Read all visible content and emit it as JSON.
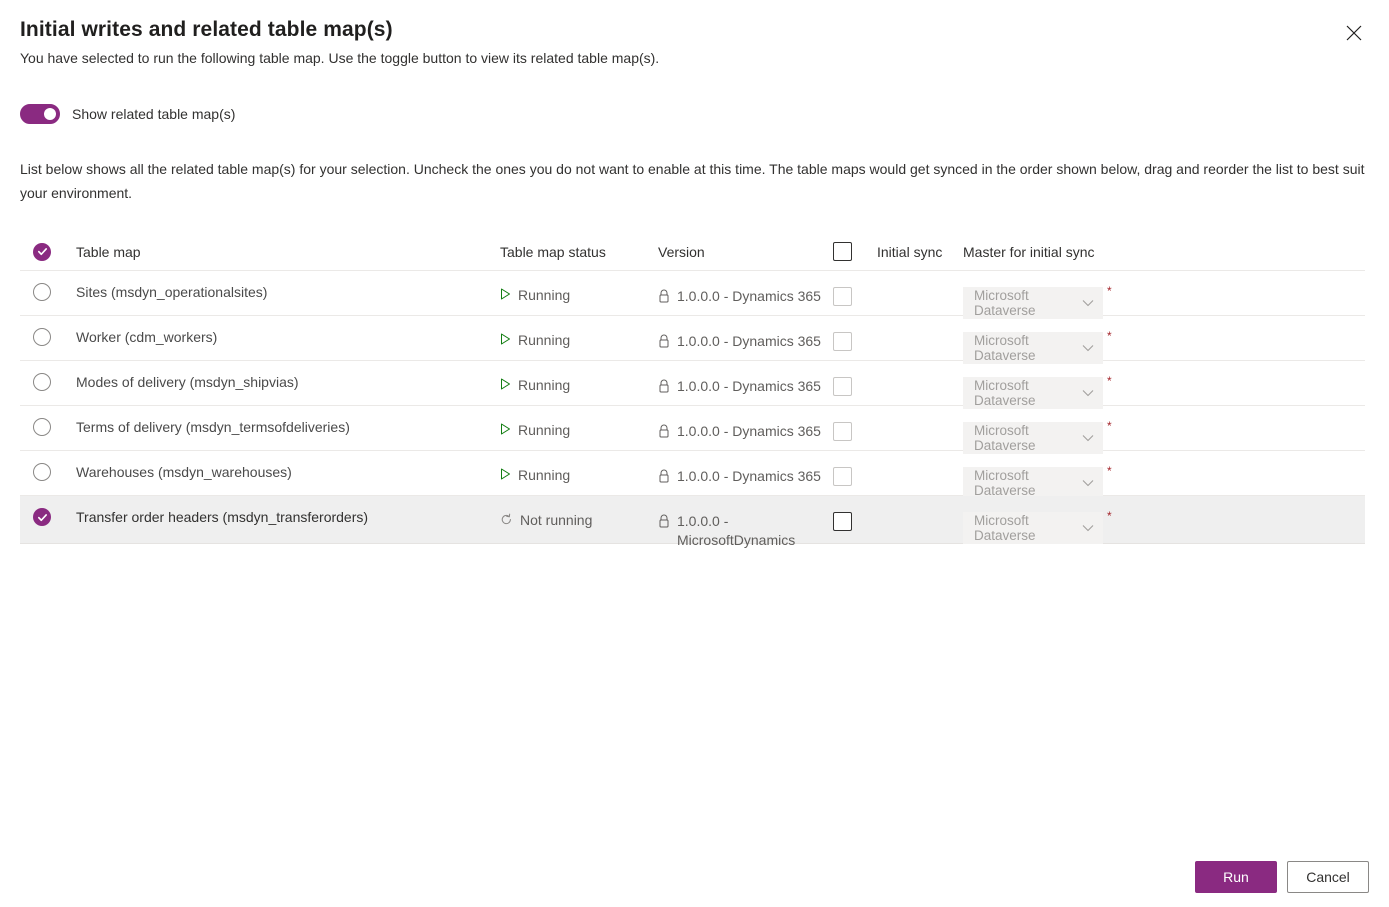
{
  "dialog": {
    "title": "Initial writes and related table map(s)",
    "subtitle": "You have selected to run the following table map. Use the toggle button to view its related table map(s).",
    "close_icon": "close-icon",
    "description": "List below shows all the related table map(s) for your selection. Uncheck the ones you do not want to enable at this time. The table maps would get synced in the order shown below, drag and reorder the list to best suit your environment."
  },
  "toggle": {
    "label": "Show related table map(s)",
    "state": "on",
    "color": "#8a2a81"
  },
  "table": {
    "headers": {
      "select_all": "select-all-checkmark",
      "table_map": "Table map",
      "status": "Table map status",
      "version": "Version",
      "initial_sync": "Initial sync",
      "master": "Master for initial sync"
    },
    "rows": [
      {
        "name": "Sites (msdyn_operationalsites)",
        "selected": false,
        "status": "Running",
        "status_icon": "play-icon",
        "version": "1.0.0.0 - Dynamics 365",
        "version_icon": "lock-icon",
        "initial_sync_checked": false,
        "master": "Microsoft Dataverse",
        "required": "*"
      },
      {
        "name": "Worker (cdm_workers)",
        "selected": false,
        "status": "Running",
        "status_icon": "play-icon",
        "version": "1.0.0.0 - Dynamics 365",
        "version_icon": "lock-icon",
        "initial_sync_checked": false,
        "master": "Microsoft Dataverse",
        "required": "*"
      },
      {
        "name": "Modes of delivery (msdyn_shipvias)",
        "selected": false,
        "status": "Running",
        "status_icon": "play-icon",
        "version": "1.0.0.0 - Dynamics 365",
        "version_icon": "lock-icon",
        "initial_sync_checked": false,
        "master": "Microsoft Dataverse",
        "required": "*"
      },
      {
        "name": "Terms of delivery (msdyn_termsofdeliveries)",
        "selected": false,
        "status": "Running",
        "status_icon": "play-icon",
        "version": "1.0.0.0 - Dynamics 365",
        "version_icon": "lock-icon",
        "initial_sync_checked": false,
        "master": "Microsoft Dataverse",
        "required": "*"
      },
      {
        "name": "Warehouses (msdyn_warehouses)",
        "selected": false,
        "status": "Running",
        "status_icon": "play-icon",
        "version": "1.0.0.0 - Dynamics 365",
        "version_icon": "lock-icon",
        "initial_sync_checked": false,
        "master": "Microsoft Dataverse",
        "required": "*"
      },
      {
        "name": "Transfer order headers (msdyn_transferorders)",
        "selected": true,
        "status": "Not running",
        "status_icon": "refresh-icon",
        "version": "1.0.0.0 - MicrosoftDynamics",
        "version_icon": "lock-icon",
        "initial_sync_checked": false,
        "master": "Microsoft Dataverse",
        "required": "*"
      }
    ]
  },
  "footer": {
    "run_label": "Run",
    "cancel_label": "Cancel"
  }
}
